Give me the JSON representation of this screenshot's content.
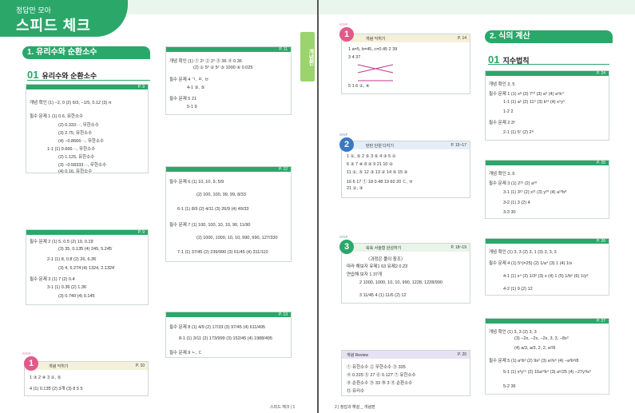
{
  "header": {
    "small": "정답만 모아",
    "big": "스피드 체크"
  },
  "left": {
    "tab": "1. 유리수와 순환소수",
    "sub_num": "01",
    "sub_title": "유리수와 순환소수",
    "box_p9a": {
      "page": "P. 9",
      "rows": [
        "개념 확인  (1) −2, 0  (2) 6/3, −1/5, 0.12  (3) π",
        "필수 문제 1  (1) 0.6, 유한소수",
        "(2) 0.333···, 무한소수",
        "(3) 2.75, 유한소수",
        "(4) −0.8666···, 무한소수",
        "1-1  (1) 0.666···, 무한소수",
        "(2) 1.125, 유한소수",
        "(3) −0.58333···, 무한소수",
        "(4) 0.16, 유한소수"
      ]
    },
    "box_p9b": {
      "page": "P. 9",
      "rows": [
        "필수 문제 2  (1) 5, 0.5̇   (2) 19, 0.1̇9̇",
        "(3) 35, 0.13̇5̇   (4) 245, 5.24̇5̇",
        "2-1  (1) 8, 0.8̇   (2) 26, 6.3̇6̇",
        "(3) 4, 5.27̇4̇   (4) 1324, 2.13̇2̇4̇",
        "필수 문제 3  (1) 7   (2) 0.4̇",
        "3-1  (1) 0.3̇6̇   (2) 1.3̇6̇",
        "(3) 0.7̇40̇   (4) 0.14̇5̇"
      ]
    },
    "box_p11": {
      "page": "P. 11",
      "rows": [
        "개념 확인  (1) ① 2²  ② 2²  ③ 36  ④ 0.36",
        "(2) ① 5²  ② 5²  ③ 1000  ④ 0.025",
        "필수 문제 4  ㄱ, ㅁ, ㅂ",
        "4-1  ③, ⑤",
        "필수 문제 5  21",
        "5-1  9"
      ]
    },
    "box_p12": {
      "page": "P. 12",
      "rows": [
        "필수 문제 6  (1) 10, 10, 9, 5/9",
        "(2) 100, 100, 99, 99, 8/33",
        "6-1  (1) 8/9  (2) 4/11  (3) 26/9  (4) 49/33",
        "필수 문제 7  (1) 100, 100, 10, 10, 90, 11/90",
        "(2) 1000, 1000, 10, 10, 990, 990, 127/330",
        "7-1  (1) 37/45  (2) 239/990  (3) 61/45  (4) 311/110"
      ]
    },
    "box_p13": {
      "page": "P. 13",
      "rows": [
        "필수 문제 8  (1) 4/9  (2) 17/33  (3) 97/45  (4) 611/495",
        "8-1  (1) 3/11  (2) 173/999  (3) 152/45  (4) 1988/495",
        "필수 문제 9  ㄴ, ㄷ"
      ]
    },
    "step1": {
      "label": "STEP",
      "num": "1",
      "title": "개념 익히기",
      "page": "P. 10",
      "rows": [
        "1  ③    2  ④    3  ①, ⑤",
        "4  (1) 0.13̇5̇  (2) 3개  (3) 8    5  5"
      ]
    },
    "vtab": "개념편",
    "footer": "스피드 체크  |  1"
  },
  "right": {
    "tab": "2. 식의 계산",
    "sub_num": "01",
    "sub_title": "지수법칙",
    "step1": {
      "label": "STEP",
      "num": "1",
      "title": "개념 익히기",
      "page": "P. 14",
      "rows": [
        "1  a=5, b=45, c=0.45    2  39",
        "3                              4  37",
        "5  1    6  ①, ④"
      ]
    },
    "step2": {
      "label": "STEP",
      "num": "2",
      "title": "탄탄 단원 다지기",
      "page": "P. 15~17",
      "rows": [
        "1  ①, ⑤   2  ⑤   3  ⑤   4  ③   5  ①",
        "6  ③   7  ④   8  ③   9  21   10  ②",
        "11  ①, ⑤   12  ③   13  ②   14  ⑤   15  ②",
        "16  6   17  ①   18  0.48   19  60   20  ㄷ, ㅂ",
        "21  ①, ③"
      ]
    },
    "step3": {
      "label": "STEP",
      "num": "3",
      "title": "쑥쑥 서술형 완성하기",
      "page": "P. 18~19",
      "rows": [
        "〈과정은 풀이 참조〉",
        "따라 해보자  유제1  63    유제2  0.2̇3̇",
        "연습해 보자  1  37개",
        "2  1000, 1000, 10, 10, 990, 1228, 1228/990",
        "3  11/45    4  (1) 11/6  (2) 12"
      ]
    },
    "review": {
      "title": "개념 Review",
      "page": "P. 20",
      "rows": [
        "① 유한소수    ② 무한소수    ③ 335",
        "④ 0.31̇5̇   ⑤ 27   ⑥ 0.12̇7̇   ⑦ 유한소수",
        "⑧ 순환소수    ⑨ 33    ⑩ 3    ⑪ 순환소수",
        "⑫ 유리수"
      ]
    },
    "box_p24": {
      "page": "P. 24",
      "rows": [
        "개념 확인  3, 5",
        "필수 문제 1  (1) x⁸  (2) 7¹⁰  (3) a⁹  (4) a⁵b⁴",
        "1-1  (1) a⁶  (2) 11⁹  (3) b¹¹  (4) x⁵y⁵",
        "1-2  2",
        "필수 문제 2  3⁶",
        "2-1  (1) 5⁷  (2) 2⁸"
      ]
    },
    "box_p25": {
      "page": "P. 25",
      "rows": [
        "개념 확인  3, 6",
        "필수 문제 3  (1) 2¹⁵  (2) a¹⁰",
        "3-1  (1) 3¹²  (2) x²¹  (3) y²⁰  (4) a¹⁰b⁸",
        "3-2  (1) 3  (2) 4",
        "3-3  30"
      ]
    },
    "box_p26": {
      "page": "P. 26",
      "rows": [
        "개념 확인  (1) 3, 3  (2) 3, 1  (3) 3, 3, 3",
        "필수 문제 4  (1) 5⁵(=25)  (2) 1/a⁴  (3) 1  (4) 1/x",
        "4-1  (1) x⁴  (2) 1/3²  (3) x  (4) 1  (5) 1/b⁶  (6) 1/y⁸",
        "4-2  (1) 9  (2) 12"
      ]
    },
    "box_p27": {
      "page": "P. 27",
      "rows": [
        "개념 확인  (1) 3, 3    (2) 3, 3",
        "(3) −2x, −2x, −2x, 3, 3, −8x³",
        "(4) a/3, a/3, 2, 2, a²/9",
        "필수 문제 5  (1) a⁹b³  (2) 9x²  (3) a²/x⁶  (4) −a³b³/8",
        "5-1  (1) x³y¹⁵  (2) 16a¹²b⁴  (3) a⁶/25  (4) −27y³/x³",
        "5-2  36"
      ]
    },
    "footer": "2  |  정답과 해설 _ 개념편"
  },
  "colors": {
    "green": "#2ba76a",
    "pink": "#e05a8a",
    "blue": "#3b78c2",
    "lime": "#9bd46c"
  }
}
